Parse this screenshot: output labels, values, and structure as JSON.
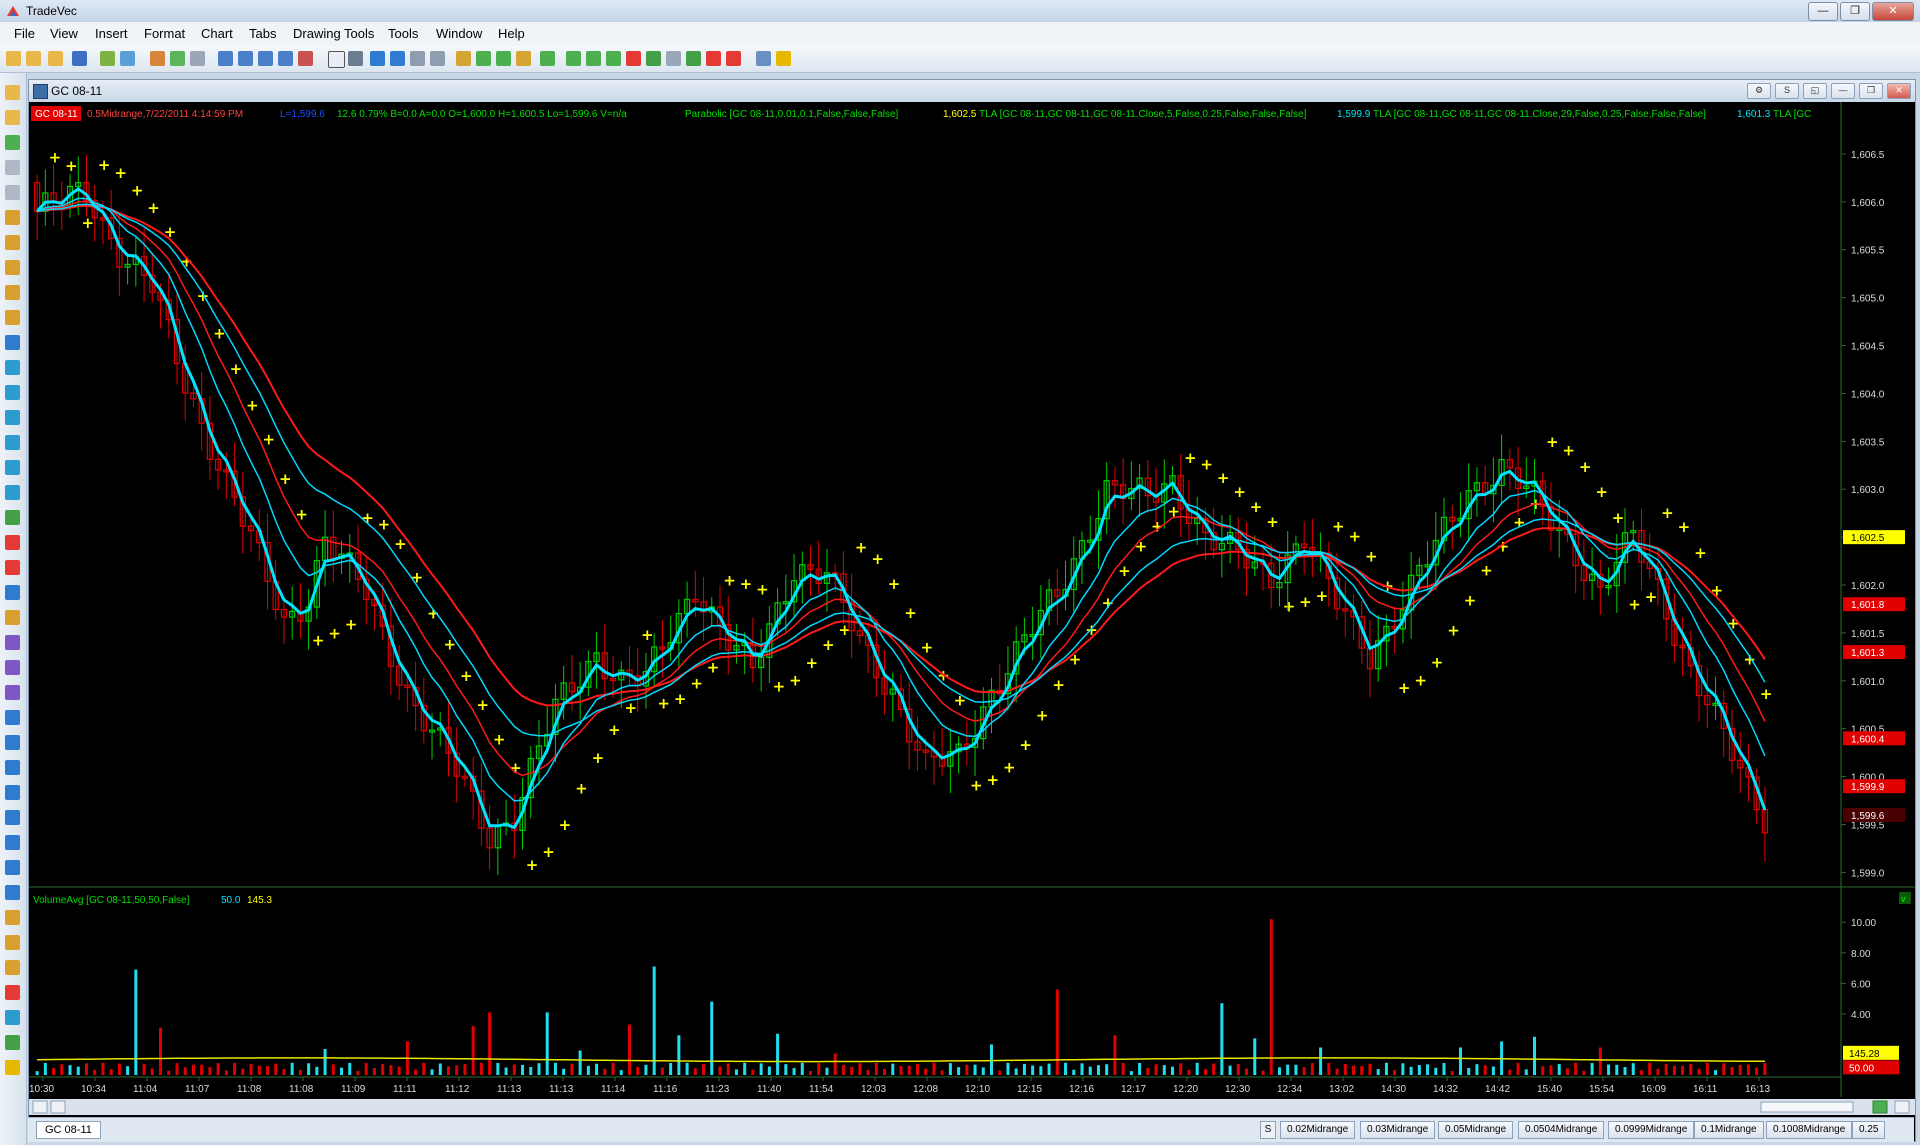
{
  "app": {
    "title": "TradeVec"
  },
  "window_buttons": {
    "minimize": "—",
    "restore": "❐",
    "close": "✕"
  },
  "menu": [
    "File",
    "View",
    "Insert",
    "Format",
    "Chart",
    "Tabs",
    "Drawing Tools",
    "Tools",
    "Window",
    "Help"
  ],
  "chart_window": {
    "title": "GC 08-11"
  },
  "header": {
    "symbol_tag": "GC 08-11",
    "info": "0.5Midrange,7/22/2011 4:14:59 PM",
    "last": "L=1,599.6",
    "stats": "12.6  0.79% B=0.0  A=0.0  O=1,600.0  H=1,600.5  Lo=1,599.6  V=n/a",
    "parabolic": "Parabolic  [GC 08-11,0.01,0.1,False,False,False]",
    "parabolic_val": "1,602.5",
    "tla1": "TLA  [GC 08-11,GC 08-11,GC 08-11.Close,5,False,0.25,False,False,False]",
    "tla1_val": "1,599.9",
    "tla2": "TLA  [GC 08-11,GC 08-11,GC 08-11.Close,29,False,0.25,False,False,False]",
    "tla2_val": "1,601.3",
    "tla3": "TLA  [GC"
  },
  "volume_header": {
    "label": "VolumeAvg  [GC 08-11,50,50,False]",
    "v1": "50.0",
    "v2": "145.3"
  },
  "price_axis_ticks": [
    "1,606.5",
    "1,606.0",
    "1,605.5",
    "1,605.0",
    "1,604.5",
    "1,604.0",
    "1,603.5",
    "1,603.0",
    "1,602.5",
    "1,602.0",
    "1,601.5",
    "1,601.0",
    "1,600.5",
    "1,600.0",
    "1,599.5",
    "1,599.0"
  ],
  "price_axis_values": [
    1606.5,
    1606.0,
    1605.5,
    1605.0,
    1604.5,
    1604.0,
    1603.5,
    1603.0,
    1602.5,
    1602.0,
    1601.5,
    1601.0,
    1600.5,
    1600.0,
    1599.5,
    1599.0
  ],
  "price_markers": [
    {
      "label": "1,602.5",
      "value": 1602.5,
      "bg": "#ffff00",
      "fg": "#000000"
    },
    {
      "label": "1,601.8",
      "value": 1601.8,
      "bg": "#e00000",
      "fg": "#ffffff"
    },
    {
      "label": "1,601.3",
      "value": 1601.3,
      "bg": "#e00000",
      "fg": "#ffffff"
    },
    {
      "label": "1,600.4",
      "value": 1600.4,
      "bg": "#e00000",
      "fg": "#ffffff"
    },
    {
      "label": "1,599.9",
      "value": 1599.9,
      "bg": "#e00000",
      "fg": "#ffffff"
    },
    {
      "label": "1,599.6",
      "value": 1599.6,
      "bg": "#4a0000",
      "fg": "#ffffff"
    }
  ],
  "volume_axis_ticks": [
    "10.00",
    "8.00",
    "6.00",
    "4.00"
  ],
  "volume_axis_values": [
    10,
    8,
    6,
    4
  ],
  "volume_markers": [
    {
      "label": "145.28",
      "value": 1.45,
      "bg": "#ffff00",
      "fg": "#000000"
    },
    {
      "label": "50.00",
      "value": 0.5,
      "bg": "#e00000",
      "fg": "#ffffff"
    }
  ],
  "time_labels": [
    "10:30",
    "10:34",
    "11:04",
    "11:07",
    "11:08",
    "11:08",
    "11:09",
    "11:11",
    "11:12",
    "11:13",
    "11:13",
    "11:14",
    "11:16",
    "11:23",
    "11:40",
    "11:54",
    "12:03",
    "12:08",
    "12:10",
    "12:15",
    "12:16",
    "12:17",
    "12:20",
    "12:30",
    "12:34",
    "13:02",
    "14:30",
    "14:32",
    "14:42",
    "15:40",
    "15:54",
    "16:09",
    "16:11",
    "16:13"
  ],
  "bottom": {
    "symbol_tab": "GC 08-11",
    "s_button": "S",
    "tabs": [
      "0.02Midrange",
      "0.03Midrange",
      "0.05Midrange",
      "0.0504Midrange",
      "0.0999Midrange",
      "0.1Midrange",
      "0.1008Midrange",
      "0.25"
    ]
  },
  "colors": {
    "up": "#00cc00",
    "down": "#e00000",
    "sar": "#ffff00",
    "fast_ma": "#00e5ff",
    "slow_ma": "#00d8ff",
    "red_ma": "#ff1a1a",
    "volume_avg": "#e6e600"
  },
  "chart_data": {
    "type": "candlestick",
    "y_range": [
      1598.9,
      1606.75
    ],
    "anchors": [
      [
        0,
        1605.9
      ],
      [
        6,
        1606.1
      ],
      [
        10,
        1605.5
      ],
      [
        14,
        1605.1
      ],
      [
        18,
        1604.1
      ],
      [
        24,
        1602.9
      ],
      [
        30,
        1601.6
      ],
      [
        33,
        1601.9
      ],
      [
        35,
        1602.5
      ],
      [
        40,
        1601.9
      ],
      [
        45,
        1600.9
      ],
      [
        52,
        1599.9
      ],
      [
        55,
        1599.4
      ],
      [
        58,
        1599.6
      ],
      [
        63,
        1600.7
      ],
      [
        68,
        1601.3
      ],
      [
        71,
        1601.0
      ],
      [
        74,
        1601.0
      ],
      [
        80,
        1602.0
      ],
      [
        84,
        1601.4
      ],
      [
        87,
        1601.1
      ],
      [
        92,
        1602.2
      ],
      [
        96,
        1602.1
      ],
      [
        100,
        1601.4
      ],
      [
        104,
        1600.9
      ],
      [
        108,
        1600.1
      ],
      [
        112,
        1600.2
      ],
      [
        116,
        1600.9
      ],
      [
        120,
        1601.4
      ],
      [
        124,
        1601.9
      ],
      [
        130,
        1603.0
      ],
      [
        135,
        1602.9
      ],
      [
        138,
        1603.1
      ],
      [
        142,
        1602.5
      ],
      [
        146,
        1602.3
      ],
      [
        150,
        1602.1
      ],
      [
        154,
        1602.5
      ],
      [
        158,
        1601.8
      ],
      [
        162,
        1601.3
      ],
      [
        166,
        1601.8
      ],
      [
        170,
        1602.4
      ],
      [
        174,
        1603.0
      ],
      [
        178,
        1603.2
      ],
      [
        182,
        1602.9
      ],
      [
        186,
        1602.5
      ],
      [
        190,
        1601.9
      ],
      [
        194,
        1602.5
      ],
      [
        197,
        1602.0
      ],
      [
        201,
        1601.1
      ],
      [
        205,
        1600.4
      ],
      [
        208,
        1599.9
      ],
      [
        210,
        1599.6
      ]
    ],
    "bar_count": 211,
    "volume_range": [
      0,
      10.8
    ],
    "volume_spikes": [
      [
        12,
        6.9
      ],
      [
        15,
        3.1
      ],
      [
        35,
        1.7
      ],
      [
        45,
        2.2
      ],
      [
        53,
        3.2
      ],
      [
        55,
        4.1
      ],
      [
        62,
        4.1
      ],
      [
        66,
        1.6
      ],
      [
        72,
        3.3
      ],
      [
        75,
        7.1
      ],
      [
        78,
        2.6
      ],
      [
        82,
        4.8
      ],
      [
        90,
        2.7
      ],
      [
        97,
        1.4
      ],
      [
        116,
        2.0
      ],
      [
        124,
        5.6
      ],
      [
        131,
        2.6
      ],
      [
        144,
        4.7
      ],
      [
        148,
        2.4
      ],
      [
        150,
        10.2
      ],
      [
        156,
        1.8
      ],
      [
        173,
        1.8
      ],
      [
        178,
        2.2
      ],
      [
        182,
        2.5
      ],
      [
        190,
        1.8
      ]
    ],
    "volume_avg": 1.0
  }
}
